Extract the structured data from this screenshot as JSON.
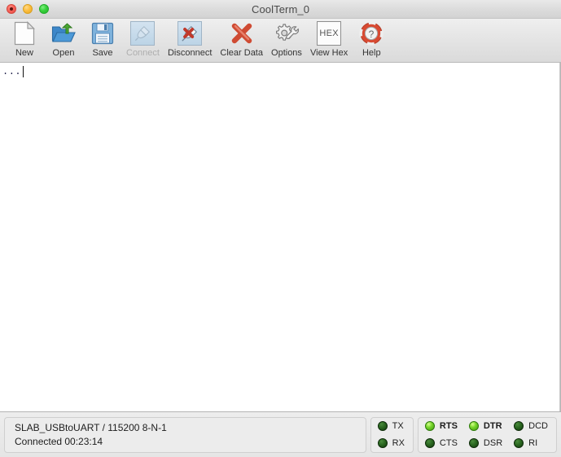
{
  "window": {
    "title": "CoolTerm_0",
    "traffic_lights": [
      "close-button",
      "minimize-button",
      "zoom-button"
    ]
  },
  "toolbar": {
    "items": [
      {
        "label": "New",
        "icon": "new-document-icon",
        "state": "enabled",
        "style": "plain"
      },
      {
        "label": "Open",
        "icon": "open-folder-icon",
        "state": "enabled",
        "style": "plain"
      },
      {
        "label": "Save",
        "icon": "floppy-disk-icon",
        "state": "enabled",
        "style": "plain"
      },
      {
        "label": "Connect",
        "icon": "plug-connect-icon",
        "state": "disabled",
        "style": "boxed"
      },
      {
        "label": "Disconnect",
        "icon": "plug-disconnect-icon",
        "state": "enabled",
        "style": "boxed"
      },
      {
        "label": "Clear Data",
        "icon": "red-x-icon",
        "state": "enabled",
        "style": "plain"
      },
      {
        "label": "Options",
        "icon": "gear-wrench-icon",
        "state": "enabled",
        "style": "plain"
      },
      {
        "label": "View Hex",
        "icon": "hex-box-icon",
        "state": "enabled",
        "style": "hexbox",
        "icon_text": "HEX"
      },
      {
        "label": "Help",
        "icon": "life-ring-help-icon",
        "state": "enabled",
        "style": "plain"
      }
    ]
  },
  "terminal": {
    "text": "...",
    "caret_visible": true,
    "background": "#ffffff",
    "text_color": "#1a1a46"
  },
  "status": {
    "connection": {
      "port_line": "SLAB_USBtoUART / 115200 8-N-1",
      "state_line": "Connected 00:23:14"
    },
    "data_leds": [
      {
        "label": "TX",
        "on": false
      },
      {
        "label": "RX",
        "on": false
      }
    ],
    "signal_leds": [
      {
        "label": "RTS",
        "on": true
      },
      {
        "label": "CTS",
        "on": false
      },
      {
        "label": "DTR",
        "on": true
      },
      {
        "label": "DSR",
        "on": false
      },
      {
        "label": "DCD",
        "on": false
      },
      {
        "label": "RI",
        "on": false
      }
    ],
    "colors": {
      "led_on": "#78d62c",
      "led_off": "#2d6b23"
    }
  }
}
